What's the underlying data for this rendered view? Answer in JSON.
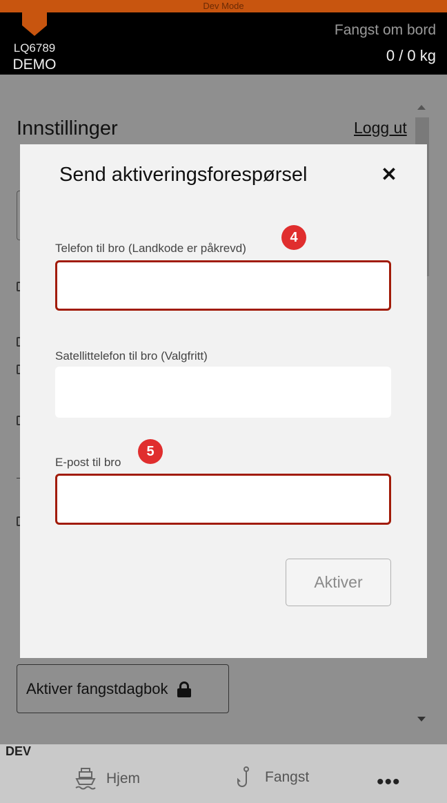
{
  "dev_banner": "Dev Mode",
  "header": {
    "vessel_id": "LQ6789",
    "vessel_name": "DEMO",
    "catch_label": "Fangst om bord",
    "catch_value": "0 / 0 kg"
  },
  "background": {
    "title": "Innstillinger",
    "logout": "Logg ut",
    "activate_logbook": "Aktiver fangstdagbok"
  },
  "modal": {
    "title": "Send aktiveringsforespørsel",
    "close_icon": "close-icon",
    "fields": [
      {
        "label": "Telefon til bro (Landkode er påkrevd)",
        "value": "",
        "badge": "4"
      },
      {
        "label": "Satellittelefon til bro (Valgfritt)",
        "value": ""
      },
      {
        "label": "E-post til bro",
        "value": "",
        "badge": "5"
      }
    ],
    "submit_label": "Aktiver"
  },
  "bottom_nav": {
    "dev_label": "DEV",
    "items": [
      {
        "label": "Hjem",
        "icon": "boat-icon"
      },
      {
        "label": "Fangst",
        "icon": "hook-icon"
      }
    ],
    "more": "•••"
  },
  "colors": {
    "accent": "#c8550f",
    "error_border": "#a11b08",
    "badge": "#e02e2e"
  }
}
